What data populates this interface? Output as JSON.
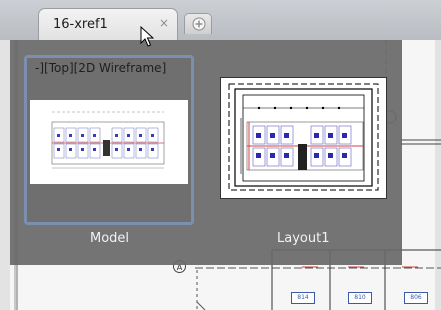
{
  "tab": {
    "title": "16-xref1",
    "close_glyph": "×"
  },
  "flyout": {
    "model": {
      "viewport_label": "-][Top][2D Wireframe]",
      "caption": "Model"
    },
    "layout": {
      "caption": "Layout1"
    }
  },
  "drawing": {
    "grid_bubble": "A",
    "room_tags": [
      "814",
      "810",
      "806"
    ]
  },
  "icons": {
    "close": "close-icon",
    "new_tab": "new-tab-icon",
    "cursor": "mouse-pointer-icon"
  },
  "colors": {
    "selection_border": "#7d8fb0",
    "flyout_background": "#696969",
    "drawing_accent": "#d04040"
  }
}
